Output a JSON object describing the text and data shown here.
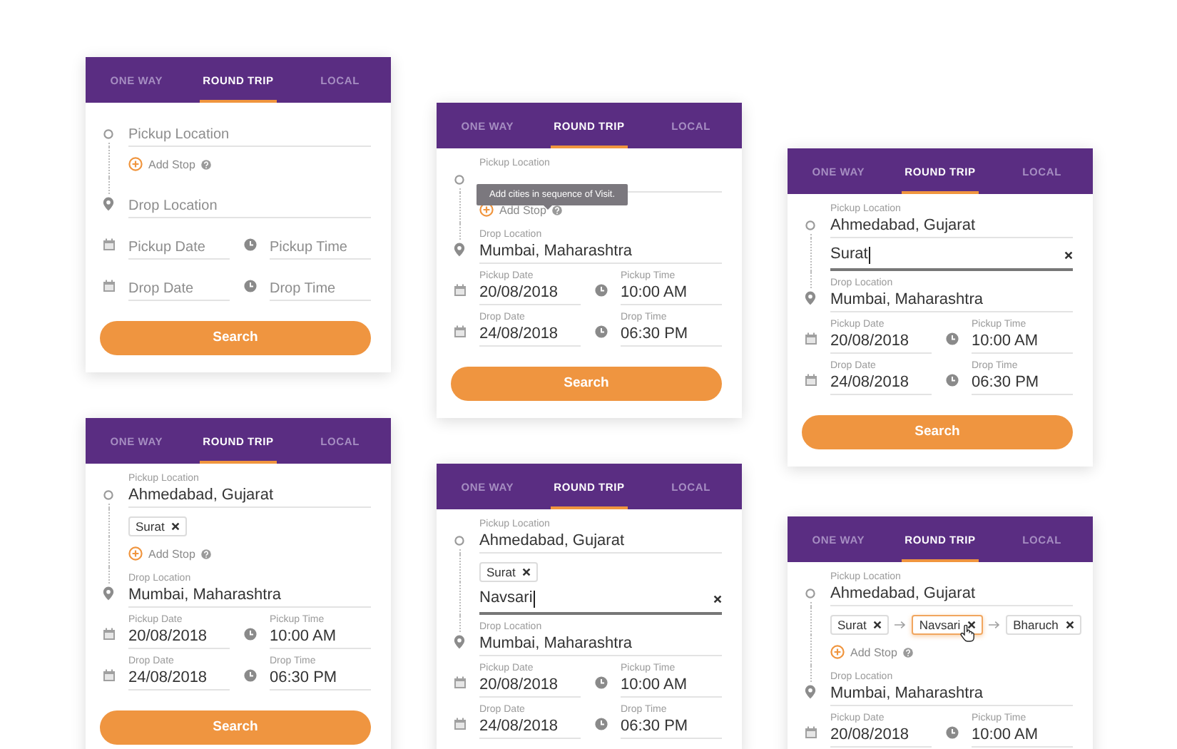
{
  "cards": [
    {
      "tabs": [
        {
          "label": "ONE WAY",
          "selected": false
        },
        {
          "label": "ROUND TRIP",
          "selected": true
        },
        {
          "label": "LOCAL",
          "selected": false
        }
      ],
      "rows": [
        {
          "kind": "pickup",
          "placeholder": "Pickup Location"
        },
        {
          "kind": "add_stop",
          "label": "Add Stop"
        },
        {
          "kind": "drop",
          "placeholder": "Drop Location"
        },
        {
          "kind": "datetime",
          "date": {
            "placeholder": "Pickup Date"
          },
          "time": {
            "placeholder": "Pickup Time"
          }
        },
        {
          "kind": "datetime",
          "date": {
            "placeholder": "Drop Date"
          },
          "time": {
            "placeholder": "Drop Time"
          }
        }
      ],
      "button": "Search"
    },
    {
      "tabs": [
        {
          "label": "ONE WAY",
          "selected": false
        },
        {
          "label": "ROUND TRIP",
          "selected": true
        },
        {
          "label": "LOCAL",
          "selected": false
        }
      ],
      "rows": [
        {
          "kind": "pickup",
          "label": "Pickup Location"
        },
        {
          "kind": "add_stop",
          "label": "Add Stop",
          "tooltip": "Add cities in sequence of Visit."
        },
        {
          "kind": "drop",
          "label": "Drop Location",
          "value": "Mumbai, Maharashtra"
        },
        {
          "kind": "datetime",
          "date": {
            "label": "Pickup Date",
            "value": "20/08/2018"
          },
          "time": {
            "label": "Pickup Time",
            "value": "10:00 AM"
          }
        },
        {
          "kind": "datetime",
          "date": {
            "label": "Drop Date",
            "value": "24/08/2018"
          },
          "time": {
            "label": "Drop Time",
            "value": "06:30 PM"
          }
        }
      ],
      "button": "Search"
    },
    {
      "tabs": [
        {
          "label": "ONE WAY",
          "selected": false
        },
        {
          "label": "ROUND TRIP",
          "selected": true
        },
        {
          "label": "LOCAL",
          "selected": false
        }
      ],
      "rows": [
        {
          "kind": "pickup",
          "label": "Pickup Location",
          "value": "Ahmedabad, Gujarat"
        },
        {
          "kind": "stop_input",
          "value": "Surat",
          "focused": true
        },
        {
          "kind": "drop",
          "label": "Drop Location",
          "value": "Mumbai, Maharashtra"
        },
        {
          "kind": "datetime",
          "date": {
            "label": "Pickup Date",
            "value": "20/08/2018"
          },
          "time": {
            "label": "Pickup Time",
            "value": "10:00 AM"
          }
        },
        {
          "kind": "datetime",
          "date": {
            "label": "Drop Date",
            "value": "24/08/2018"
          },
          "time": {
            "label": "Drop Time",
            "value": "06:30 PM"
          }
        }
      ],
      "button": "Search"
    },
    {
      "tabs": [
        {
          "label": "ONE WAY",
          "selected": false
        },
        {
          "label": "ROUND TRIP",
          "selected": true
        },
        {
          "label": "LOCAL",
          "selected": false
        }
      ],
      "rows": [
        {
          "kind": "pickup",
          "label": "Pickup Location",
          "value": "Ahmedabad, Gujarat"
        },
        {
          "kind": "stops",
          "chips": [
            {
              "text": "Surat",
              "hovered": false
            }
          ]
        },
        {
          "kind": "add_stop",
          "label": "Add Stop"
        },
        {
          "kind": "drop",
          "label": "Drop Location",
          "value": "Mumbai, Maharashtra"
        },
        {
          "kind": "datetime",
          "date": {
            "label": "Pickup Date",
            "value": "20/08/2018"
          },
          "time": {
            "label": "Pickup Time",
            "value": "10:00 AM"
          }
        },
        {
          "kind": "datetime",
          "date": {
            "label": "Drop Date",
            "value": "24/08/2018"
          },
          "time": {
            "label": "Drop Time",
            "value": "06:30 PM"
          }
        }
      ],
      "button": "Search"
    },
    {
      "tabs": [
        {
          "label": "ONE WAY",
          "selected": false
        },
        {
          "label": "ROUND TRIP",
          "selected": true
        },
        {
          "label": "LOCAL",
          "selected": false
        }
      ],
      "rows": [
        {
          "kind": "pickup",
          "label": "Pickup Location",
          "value": "Ahmedabad, Gujarat"
        },
        {
          "kind": "stops",
          "chips": [
            {
              "text": "Surat",
              "hovered": false
            }
          ]
        },
        {
          "kind": "stop_input",
          "value": "Navsari",
          "focused": true
        },
        {
          "kind": "drop",
          "label": "Drop Location",
          "value": "Mumbai, Maharashtra"
        },
        {
          "kind": "datetime",
          "date": {
            "label": "Pickup Date",
            "value": "20/08/2018"
          },
          "time": {
            "label": "Pickup Time",
            "value": "10:00 AM"
          }
        },
        {
          "kind": "datetime",
          "date": {
            "label": "Drop Date",
            "value": "24/08/2018"
          },
          "time": {
            "label": "Drop Time",
            "value": "06:30 PM"
          }
        }
      ]
    },
    {
      "tabs": [
        {
          "label": "ONE WAY",
          "selected": false
        },
        {
          "label": "ROUND TRIP",
          "selected": true
        },
        {
          "label": "LOCAL",
          "selected": false
        }
      ],
      "rows": [
        {
          "kind": "pickup",
          "label": "Pickup Location",
          "value": "Ahmedabad, Gujarat"
        },
        {
          "kind": "stops",
          "chips": [
            {
              "text": "Surat",
              "hovered": false
            },
            {
              "text": "Navsari",
              "hovered": true
            },
            {
              "text": "Bharuch",
              "hovered": false
            }
          ]
        },
        {
          "kind": "add_stop",
          "label": "Add Stop"
        },
        {
          "kind": "drop",
          "label": "Drop Location",
          "value": "Mumbai, Maharashtra"
        },
        {
          "kind": "datetime",
          "date": {
            "label": "Pickup Date",
            "value": "20/08/2018"
          },
          "time": {
            "label": "Pickup Time",
            "value": "10:00 AM"
          }
        }
      ]
    }
  ]
}
